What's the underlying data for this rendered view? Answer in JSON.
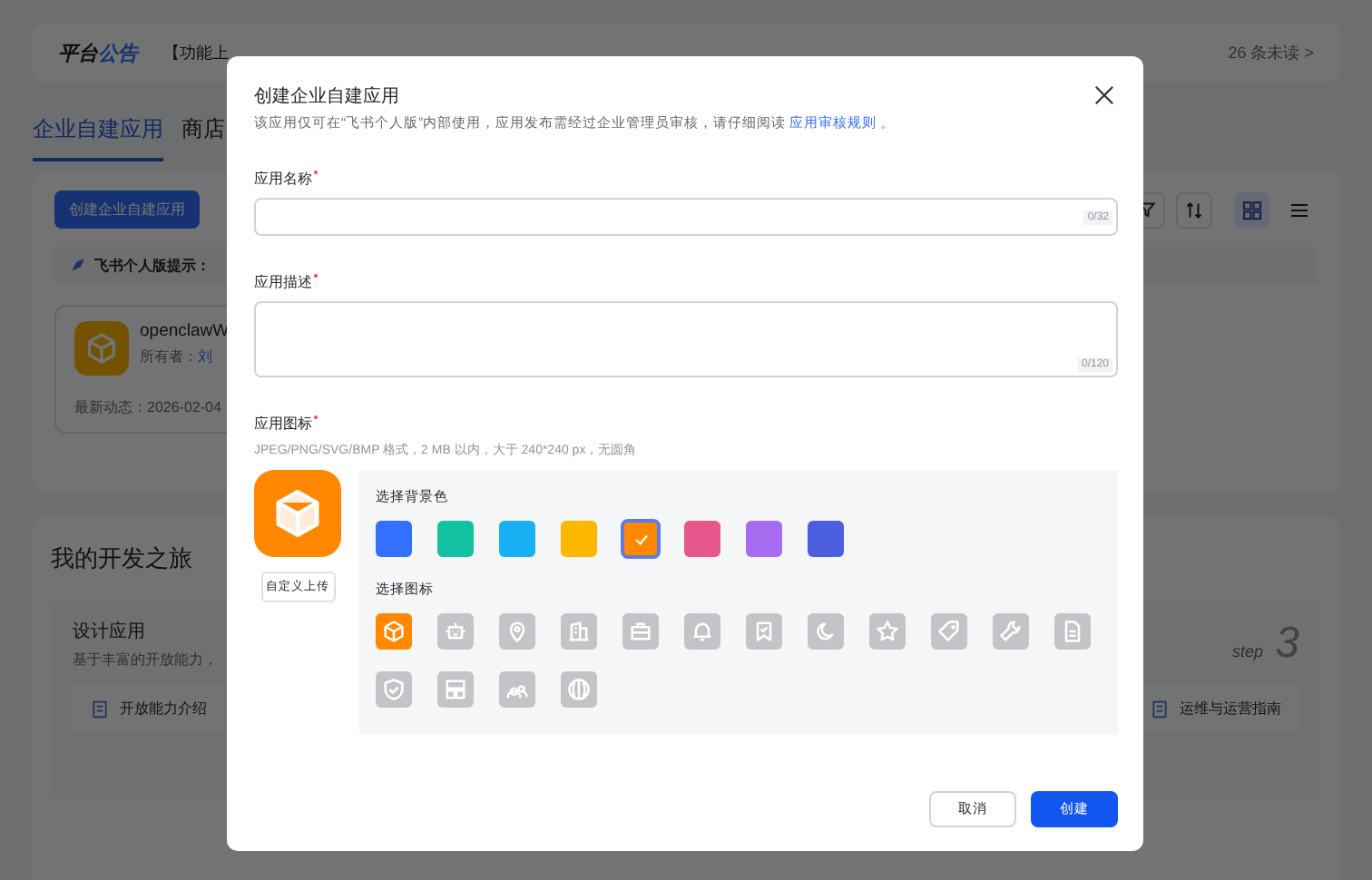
{
  "background_page": {
    "notice": {
      "title_part_1": "平台",
      "title_part_2": "公告",
      "text": "【功能上",
      "unread": "26 条未读 >"
    },
    "tabs": [
      {
        "label": "企业自建应用",
        "selected": true
      },
      {
        "label": "商店",
        "selected": false
      }
    ],
    "create_button": "创建企业自建应用",
    "tip": "飞书个人版提示：",
    "app_card": {
      "name": "openclawW",
      "owner_label": "所有者：",
      "owner": "刘",
      "activity": "最新动态：2026-02-04"
    },
    "journey": {
      "title": "我的开发之旅",
      "step_title": "设计应用",
      "step_text": "基于丰富的开放能力，",
      "step_no": "3",
      "step_word": "step",
      "links": [
        "开放能力介绍",
        "运维与运营指南"
      ]
    }
  },
  "dialog": {
    "title": "创建企业自建应用",
    "description": "该应用仅可在“飞书个人版”内部使用，应用发布需经过企业管理员审核，请仔细阅读",
    "link": "应用审核规则",
    "description_end": "。",
    "fields": [
      {
        "label": "应用名称",
        "required": true,
        "counter": "0/32",
        "kind": "input"
      },
      {
        "label": "应用描述",
        "required": true,
        "counter": "0/120",
        "kind": "textarea"
      }
    ],
    "icon_section": {
      "label": "应用图标",
      "required": true,
      "hint": "JPEG/PNG/SVG/BMP 格式，2 MB 以内，大于 240*240 px，无圆角",
      "upload_button": "自定义上传",
      "bg_label": "选择背景色",
      "colors": [
        {
          "color": "#3370ff",
          "selected": false
        },
        {
          "color": "#12c2a0",
          "selected": false
        },
        {
          "color": "#18b1f3",
          "selected": false
        },
        {
          "color": "#ffb800",
          "selected": false
        },
        {
          "color": "#ff8800",
          "selected": true
        },
        {
          "color": "#e8578c",
          "selected": false
        },
        {
          "color": "#a56cf0",
          "selected": false
        },
        {
          "color": "#4b5fe0",
          "selected": false
        }
      ],
      "icon_label": "选择图标",
      "icons": [
        {
          "selected": true
        },
        {
          "selected": false
        },
        {
          "selected": false
        },
        {
          "selected": false
        },
        {
          "selected": false
        },
        {
          "selected": false
        },
        {
          "selected": false
        },
        {
          "selected": false
        },
        {
          "selected": false
        },
        {
          "selected": false
        },
        {
          "selected": false
        },
        {
          "selected": false
        },
        {
          "selected": false
        },
        {
          "selected": false
        },
        {
          "selected": false
        },
        {
          "selected": false
        }
      ]
    },
    "buttons": [
      {
        "label": "取消",
        "kind": "secondary"
      },
      {
        "label": "创建",
        "kind": "primary"
      }
    ]
  }
}
